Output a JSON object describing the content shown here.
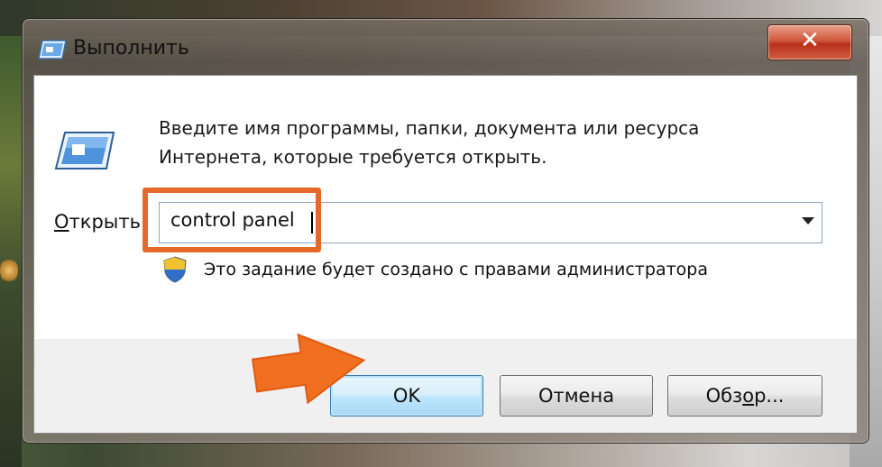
{
  "window": {
    "title": "Выполнить",
    "close_label": "✕"
  },
  "dialog": {
    "description_line1": "Введите имя программы, папки, документа или ресурса",
    "description_line2": "Интернета, которые требуется открыть.",
    "open_label_prefix": "",
    "open_label_underlined": "О",
    "open_label_rest": "ткрыть:",
    "open_value": "control panel",
    "admin_note": "Это задание будет создано с правами администратора"
  },
  "buttons": {
    "ok": "OK",
    "cancel": "Отмена",
    "browse_prefix": "Обз",
    "browse_underlined": "о",
    "browse_rest": "р..."
  },
  "colors": {
    "highlight": "#e56a2a",
    "arrow": "#f07020",
    "ok_border": "#3c7fb1"
  },
  "icons": {
    "title": "run-icon",
    "main": "run-icon",
    "admin": "uac-shield-icon",
    "close": "close-icon",
    "dropdown": "chevron-down-icon"
  }
}
